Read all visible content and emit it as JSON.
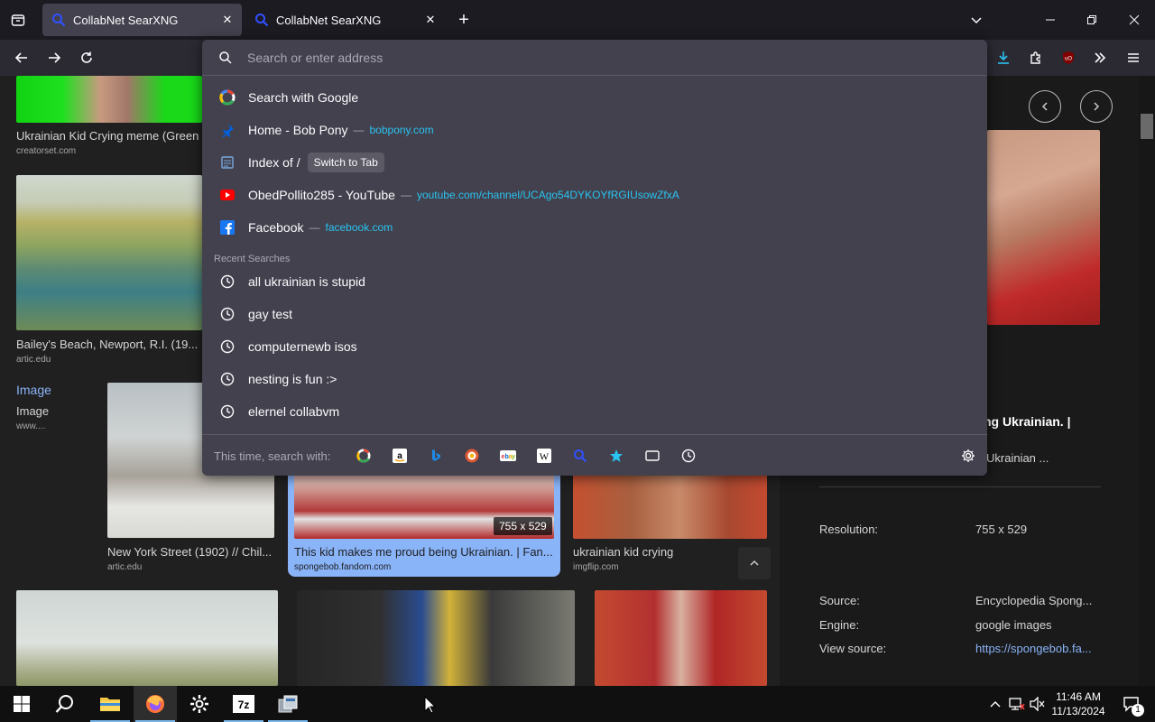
{
  "tabs": [
    {
      "title": "CollabNet SearXNG",
      "active": true
    },
    {
      "title": "CollabNet SearXNG",
      "active": false
    }
  ],
  "urlbar": {
    "placeholder": "Search or enter address",
    "results": [
      {
        "title": "Search with Google",
        "url": "",
        "icon": "google-icon"
      },
      {
        "title": "Home - Bob Pony",
        "url": "bobpony.com",
        "icon": "pin-icon"
      },
      {
        "title": "Index of /",
        "url": "",
        "action": "Switch to Tab",
        "icon": "page-icon"
      },
      {
        "title": "ObedPollito285 - YouTube",
        "url": "youtube.com/channel/UCAgo54DYKOYfRGIUsowZfxA",
        "icon": "youtube-icon"
      },
      {
        "title": "Facebook",
        "url": "facebook.com",
        "icon": "facebook-icon"
      }
    ],
    "recent_label": "Recent Searches",
    "recent": [
      "all ukrainian is stupid",
      "gay test",
      "computernewb isos",
      "nesting is fun :>",
      "elernel collabvm"
    ],
    "separator": "—",
    "oneoff_label": "This time, search with:",
    "oneoff_engines": [
      "google-icon",
      "amazon-icon",
      "bing-icon",
      "duckduckgo-icon",
      "ebay-icon",
      "wikipedia-icon",
      "searxng-icon",
      "bookmarks-icon",
      "tabs-icon",
      "history-icon"
    ]
  },
  "results": [
    {
      "caption": "Ukrainian Kid Crying meme (Green ...",
      "source": "creatorset.com"
    },
    {
      "caption": "Bailey's Beach, Newport, R.I. (19...",
      "source": "artic.edu"
    },
    {
      "caption": "Image",
      "sub": "Image",
      "source": "www...."
    },
    {
      "caption": "New York Street (1902) // Chil...",
      "source": "artic.edu"
    },
    {
      "caption": "This kid makes me proud being Ukrainian. | Fan...",
      "source": "spongebob.fandom.com",
      "badge": "755 x 529"
    },
    {
      "caption": "ukrainian kid crying",
      "source": "imgflip.com"
    }
  ],
  "detail": {
    "title_part": "ng Ukrainian. |",
    "sub_part": "Ukrainian ...",
    "rows": [
      {
        "label": "Resolution:",
        "value": "755 x 529"
      },
      {
        "label": "Source:",
        "value": "Encyclopedia Spong..."
      },
      {
        "label": "Engine:",
        "value": "google images"
      },
      {
        "label": "View source:",
        "value": "https://spongebob.fa..."
      }
    ]
  },
  "taskbar": {
    "time": "11:46 AM",
    "date": "11/13/2024",
    "notifications": "1"
  }
}
